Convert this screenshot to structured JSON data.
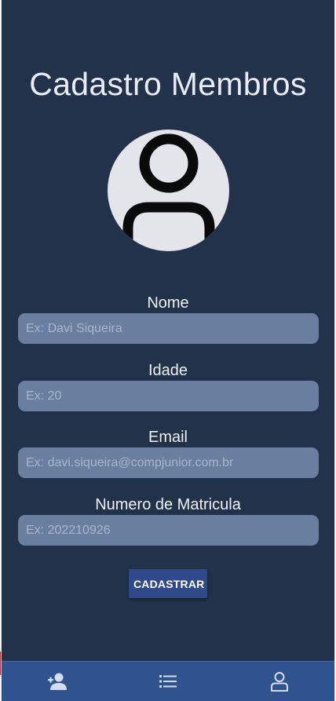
{
  "header": {
    "title": "Cadastro Membros"
  },
  "avatar": {
    "icon": "user-icon"
  },
  "form": {
    "fields": [
      {
        "label": "Nome",
        "placeholder": "Ex: Davi Siqueira",
        "value": ""
      },
      {
        "label": "Idade",
        "placeholder": "Ex: 20",
        "value": ""
      },
      {
        "label": "Email",
        "placeholder": "Ex: davi.siqueira@compjunior.com.br",
        "value": ""
      },
      {
        "label": "Numero de Matricula",
        "placeholder": "Ex: 202210926",
        "value": ""
      }
    ],
    "submit_label": "CADASTRAR"
  },
  "nav": {
    "items": [
      {
        "icon": "add-user-icon"
      },
      {
        "icon": "list-icon"
      },
      {
        "icon": "profile-icon"
      }
    ]
  },
  "colors": {
    "background": "#22324b",
    "input": "#6a7fa0",
    "button": "#2f4a8a",
    "nav": "#30538f"
  }
}
